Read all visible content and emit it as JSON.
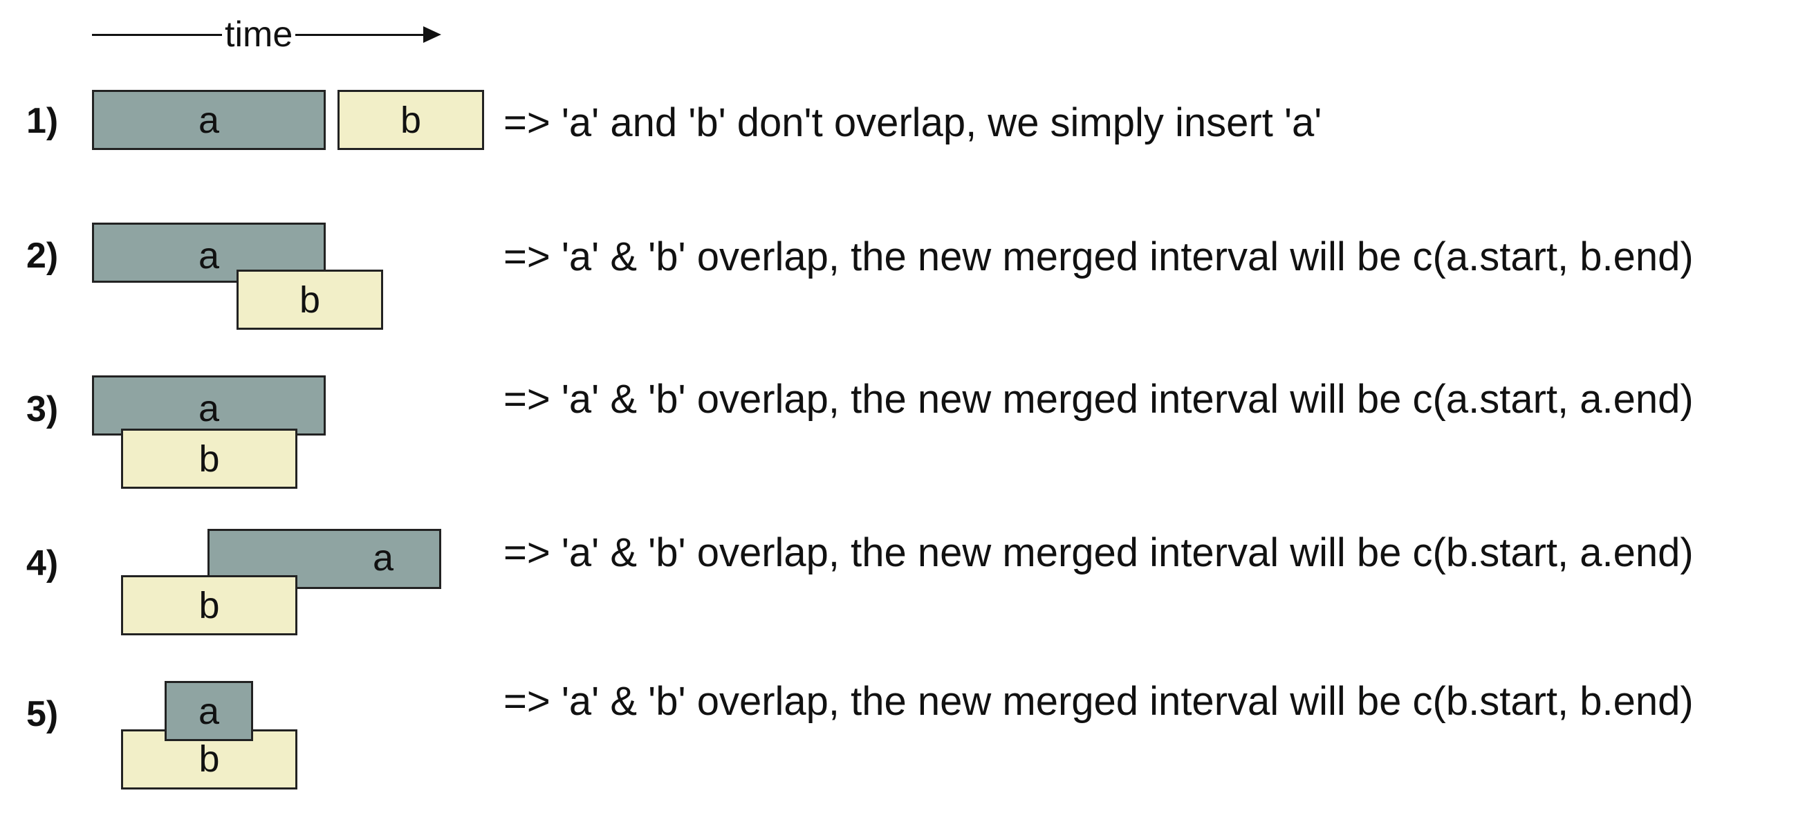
{
  "axis": {
    "label": "time"
  },
  "colors": {
    "interval_a": "#8fa4a2",
    "interval_b": "#f2efc8",
    "outline": "#222222"
  },
  "rows": [
    {
      "number": "1)",
      "a_label": "a",
      "b_label": "b",
      "description": "=> 'a' and 'b' don't overlap, we simply insert 'a'"
    },
    {
      "number": "2)",
      "a_label": "a",
      "b_label": "b",
      "description": "=> 'a' & 'b' overlap, the new merged interval will be c(a.start, b.end)"
    },
    {
      "number": "3)",
      "a_label": "a",
      "b_label": "b",
      "description": "=> 'a' & 'b' overlap, the new merged interval will be c(a.start, a.end)"
    },
    {
      "number": "4)",
      "a_label": "a",
      "b_label": "b",
      "description": "=> 'a' & 'b' overlap, the new merged interval will be c(b.start, a.end)"
    },
    {
      "number": "5)",
      "a_label": "a",
      "b_label": "b",
      "description": "=> 'a' & 'b' overlap, the new merged interval will be c(b.start, b.end)"
    }
  ]
}
